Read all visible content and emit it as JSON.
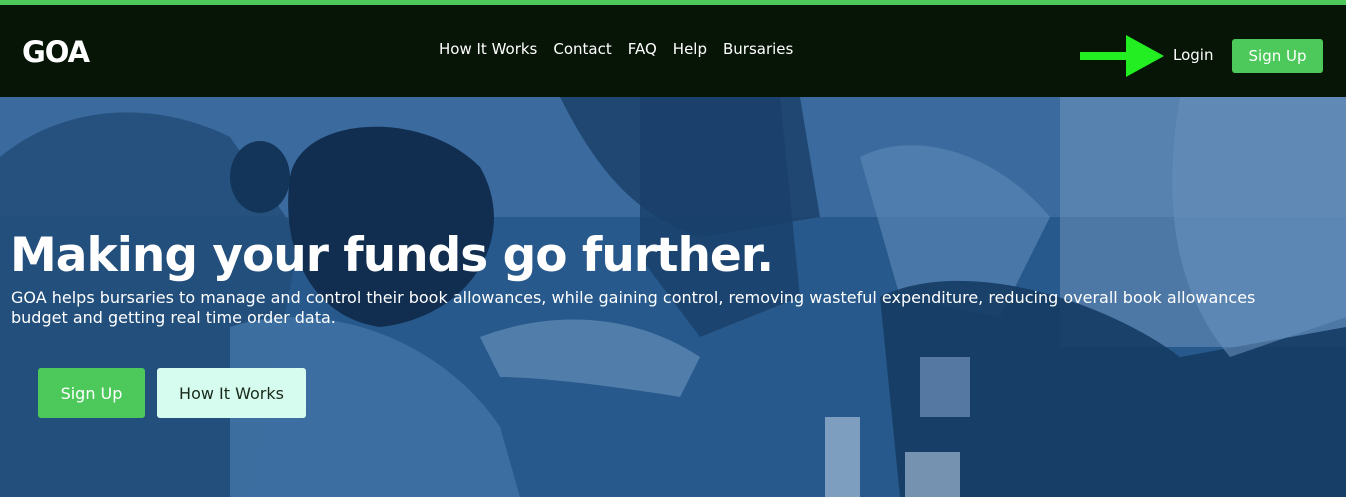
{
  "brand": {
    "logo_text": "GOA"
  },
  "nav": {
    "links": [
      {
        "label": "How It Works"
      },
      {
        "label": "Contact"
      },
      {
        "label": "FAQ"
      },
      {
        "label": "Help"
      },
      {
        "label": "Bursaries"
      }
    ],
    "login_label": "Login",
    "signup_label": "Sign Up"
  },
  "annotation": {
    "icon": "green-arrow-pointing-right",
    "color": "#22ee22"
  },
  "hero": {
    "headline": "Making your funds go further.",
    "subtext": "GOA helps bursaries to manage and control their book allowances, while gaining control, removing wasteful expenditure, reducing overall book allowances budget and getting real time order data.",
    "primary_button": "Sign Up",
    "secondary_button": "How It Works"
  },
  "colors": {
    "accent_green": "#4cc95a",
    "nav_background": "#071507",
    "hero_overlay": "#1f4f80",
    "secondary_button_bg": "#d6fbef"
  }
}
